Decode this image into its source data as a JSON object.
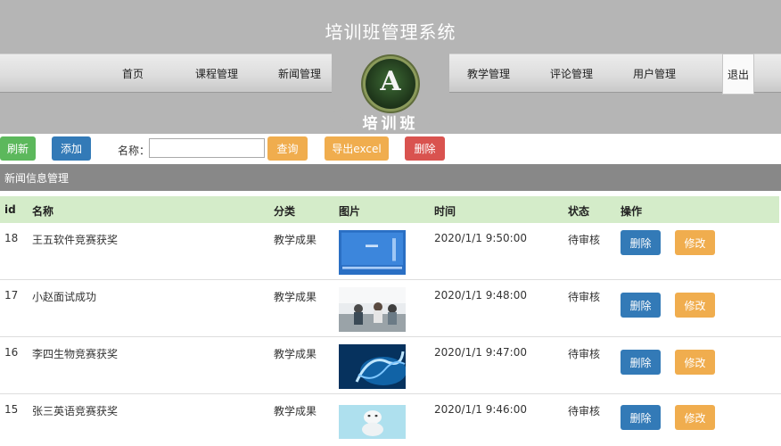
{
  "app": {
    "title": "培训班管理系统",
    "logo_letter": "A",
    "logo_text": "培训班"
  },
  "nav": {
    "items": [
      "首页",
      "课程管理",
      "新闻管理",
      "教学管理",
      "评论管理",
      "用户管理"
    ],
    "logout": "退出"
  },
  "toolbar": {
    "refresh": "刷新",
    "add": "添加",
    "name_label": "名称：",
    "search_value": "",
    "search_placeholder": "",
    "query": "查询",
    "export": "导出excel",
    "delete": "删除"
  },
  "section_title": "新闻信息管理",
  "table": {
    "headers": [
      "id",
      "名称",
      "分类",
      "图片",
      "时间",
      "状态",
      "操作"
    ],
    "rows": [
      {
        "id": "18",
        "name": "王五软件竞赛获奖",
        "category": "教学成果",
        "time": "2020/1/1 9:50:00",
        "status": "待审核",
        "delete": "删除",
        "edit": "修改",
        "thumb": "software-screenshot"
      },
      {
        "id": "17",
        "name": "小赵面试成功",
        "category": "教学成果",
        "time": "2020/1/1 9:48:00",
        "status": "待审核",
        "delete": "删除",
        "edit": "修改",
        "thumb": "interview-photo"
      },
      {
        "id": "16",
        "name": "李四生物竞赛获奖",
        "category": "教学成果",
        "time": "2020/1/1 9:47:00",
        "status": "待审核",
        "delete": "删除",
        "edit": "修改",
        "thumb": "dna-helix"
      },
      {
        "id": "15",
        "name": "张三英语竞赛获奖",
        "category": "教学成果",
        "time": "2020/1/1 9:46:00",
        "status": "待审核",
        "delete": "删除",
        "edit": "修改",
        "thumb": "english-cartoon"
      }
    ]
  },
  "colors": {
    "header_bg": "#b5b5b5",
    "section_bg": "#888888",
    "table_header_bg": "#d4ecc9",
    "btn_green": "#5cb85c",
    "btn_blue": "#337ab7",
    "btn_orange": "#f0ad4e",
    "btn_red": "#d9534f"
  }
}
